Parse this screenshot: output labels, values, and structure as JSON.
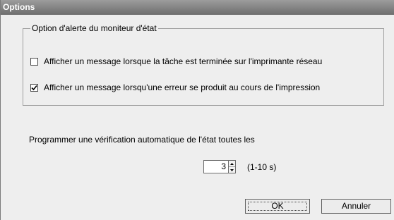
{
  "window": {
    "title": "Options"
  },
  "alert_group": {
    "title": "Option d'alerte du moniteur d'état",
    "options": [
      {
        "label": "Afficher un message lorsque la tâche est terminée sur l'imprimante réseau",
        "checked": false
      },
      {
        "label": "Afficher un message lorsqu'une erreur se produit au cours de l'impression",
        "checked": true
      }
    ]
  },
  "schedule": {
    "label": "Programmer une vérification automatique de l'état toutes les",
    "value": "3",
    "range": "(1-10 s)"
  },
  "buttons": {
    "ok": "OK",
    "cancel": "Annuler"
  },
  "colors": {
    "titlebar": "#808080",
    "dialog_bg": "#eeeeee"
  }
}
